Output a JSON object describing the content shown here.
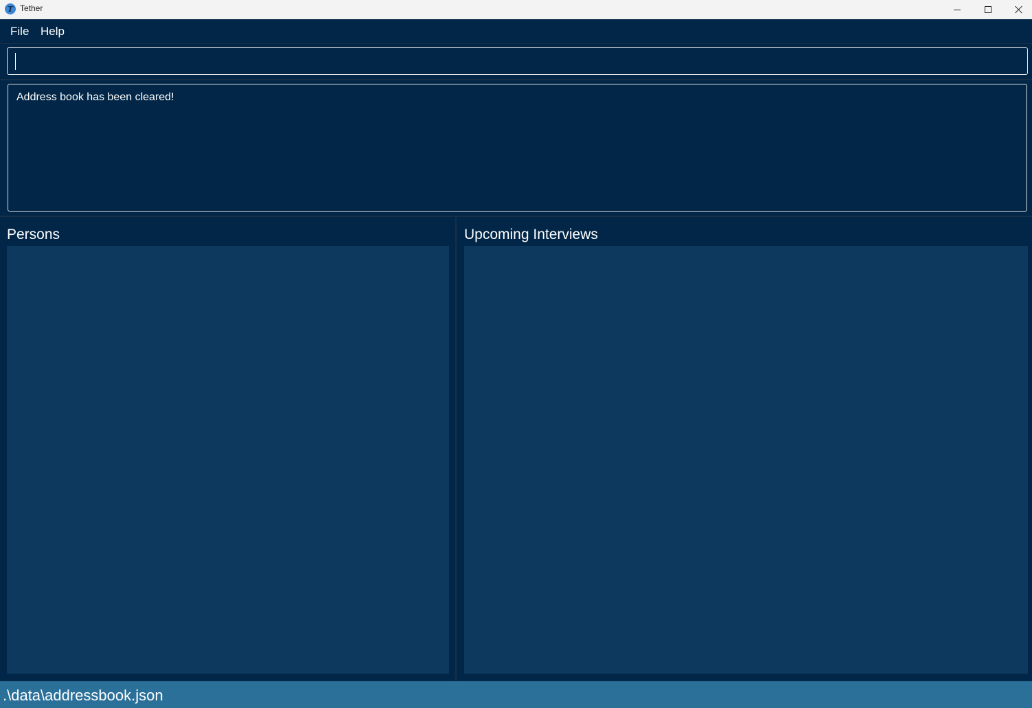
{
  "window": {
    "title": "Tether",
    "icon": "tether-logo-icon",
    "controls": [
      "minimize-icon",
      "maximize-icon",
      "close-icon"
    ]
  },
  "menu": {
    "file_label": "File",
    "help_label": "Help"
  },
  "command": {
    "value": ""
  },
  "result": {
    "message": "Address book has been cleared!"
  },
  "panels": {
    "persons_title": "Persons",
    "interviews_title": "Upcoming Interviews"
  },
  "status": {
    "file_path": ".\\data\\addressbook.json"
  },
  "colors": {
    "background": "#012647",
    "list_panel": "#0d395f",
    "status_bar": "#2a7099",
    "title_bar": "#f3f3f3"
  }
}
